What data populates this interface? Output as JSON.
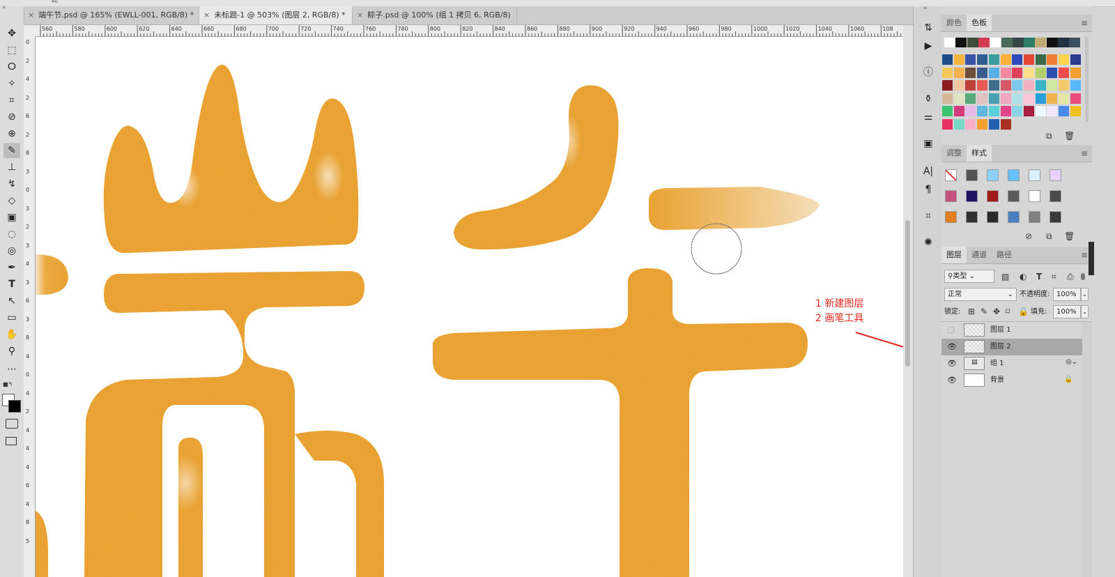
{
  "top_strip": {
    "fragment": "40"
  },
  "tabs": [
    {
      "label": "端午节.psd @ 165% (EWLL-001, RGB/8) *",
      "close": "×"
    },
    {
      "label": "未标题-1 @ 503% (图层 2, RGB/8) *",
      "close": "×"
    },
    {
      "label": "粽子.psd @ 100% (组 1 拷贝 6, RGB/8)",
      "close": "×"
    }
  ],
  "ruler": {
    "h_ticks": [
      "560",
      "580",
      "600",
      "620",
      "640",
      "660",
      "680",
      "700",
      "720",
      "740",
      "760",
      "780",
      "800",
      "820",
      "840",
      "860",
      "880",
      "900",
      "920",
      "940",
      "960",
      "980",
      "1000",
      "1020",
      "1040",
      "1060",
      "108"
    ],
    "v_ticks": [
      "0",
      "2",
      "4",
      "2",
      "6",
      "2",
      "8",
      "3",
      "0",
      "3",
      "2",
      "3",
      "4",
      "3",
      "6",
      "3",
      "8",
      "4",
      "0",
      "4",
      "2",
      "4",
      "4",
      "4",
      "6",
      "4",
      "8",
      "5"
    ]
  },
  "toolbar": {
    "collapse": "»",
    "tools": [
      "move-tool",
      "marquee-tool",
      "lasso-tool",
      "magic-wand-tool",
      "crop-tool",
      "eyedropper-tool",
      "healing-brush-tool",
      "brush-tool",
      "clone-stamp-tool",
      "history-brush-tool",
      "eraser-tool",
      "gradient-tool",
      "blur-tool",
      "dodge-tool",
      "pen-tool",
      "type-tool",
      "path-selection-tool",
      "rectangle-tool",
      "hand-tool",
      "zoom-tool",
      "more-tools"
    ],
    "glyphs": [
      "✥",
      "⬚",
      "ⵔ",
      "✧",
      "⌗",
      "⊘",
      "⊕",
      "✎",
      "⊥",
      "↯",
      "◇",
      "▣",
      "◌",
      "◎",
      "✒",
      "T",
      "↖",
      "▭",
      "✋",
      "⚲",
      "⋯"
    ],
    "selected": "brush-tool"
  },
  "colors": {
    "swatch_panel_tab_colors": "颜色",
    "swatch_panel_tab_swatches": "色板",
    "swatches_top": [
      "#ffffff",
      "#111111",
      "#3e4d3a",
      "#d43c54",
      "#ffffff",
      "#4a6a5a",
      "#334744",
      "#2d7c6a",
      "#c0ab74",
      "#111111",
      "#203244",
      "#3a5060"
    ],
    "swatches_grid": [
      [
        "#1e4c8a",
        "#f2b640",
        "#3b52a4",
        "#2e5e8f",
        "#3a9c9c",
        "#ffb13a",
        "#2e47b8",
        "#e24736",
        "#3a6b46",
        "#f07d33",
        "#ffd34a",
        "#2d3b8f"
      ],
      [
        "#f6c85a",
        "#f3b04c",
        "#6b4e3a",
        "#3a5d8f",
        "#5aaee8",
        "#f38aa0",
        "#e0425a",
        "#ffe08a",
        "#b0d06a",
        "#2a4fb0",
        "#ee4c4c",
        "#f0a030"
      ],
      [
        "#8a1e1e",
        "#f5c7a2",
        "#c0403a",
        "#e85a54",
        "#3e6d8c",
        "#d45a6a",
        "#7ec8ec",
        "#f4b2c0",
        "#3cb4c8",
        "#cfe8a0",
        "#f7c86a",
        "#59b8f8"
      ],
      [
        "#d8b89a",
        "#e1e4c0",
        "#58a878",
        "#e0c2c0",
        "#4aa0b0",
        "#f0a8c0",
        "#b0e0e8",
        "#f9c6d8",
        "#2a9ed8",
        "#f1b44c",
        "#eae6a6",
        "#e84c7a"
      ],
      [
        "#3cc470",
        "#d03c7c",
        "#e8b8e8",
        "#60b8e0",
        "#5bd0d8",
        "#e04488",
        "#8ad4e8",
        "#a82040",
        "#f0f8ff",
        "#f0e8ff",
        "#4a8ae8",
        "#f0c020"
      ],
      [
        "#e83064",
        "#7ad8c8",
        "#f8b0c8",
        "#f4a030",
        "#2060b0",
        "#a83020"
      ]
    ],
    "annotation": "#e0271f",
    "orange": "#f0a331",
    "selected_layer_bg": "#a8a8a8"
  },
  "styles_panel": {
    "tab_adjust": "调整",
    "tab_styles": "样式",
    "styles": [
      [
        "#ffffff",
        "#555555",
        "#8bd0ff",
        "#66c2ff",
        "#d9f0ff",
        "#e8d0ff"
      ],
      [
        "#c85080",
        "#201060",
        "#a01818",
        "#5a5a5a",
        "#ffffff",
        "#4a4a4a"
      ],
      [
        "#e08020",
        "#303030",
        "#2a2a2a",
        "#4a80c0",
        "#808080",
        "#3a3a3a"
      ]
    ]
  },
  "layers_panel": {
    "tabs": [
      "图层",
      "通道",
      "路径"
    ],
    "filter_label": "类型",
    "blend_mode": "正常",
    "opacity_label": "不透明度:",
    "opacity_value": "100%",
    "lock_label": "锁定:",
    "fill_label": "填充:",
    "fill_value": "100%",
    "layers": [
      {
        "name": "图层 1",
        "visible": false,
        "selected": false
      },
      {
        "name": "图层 2",
        "visible": true,
        "selected": true
      },
      {
        "name": "组 1",
        "visible": true,
        "selected": false
      },
      {
        "name": "背景",
        "visible": true,
        "selected": false
      }
    ]
  },
  "annotation": {
    "line1": "1 新建图层",
    "line2": "2 画笔工具"
  }
}
